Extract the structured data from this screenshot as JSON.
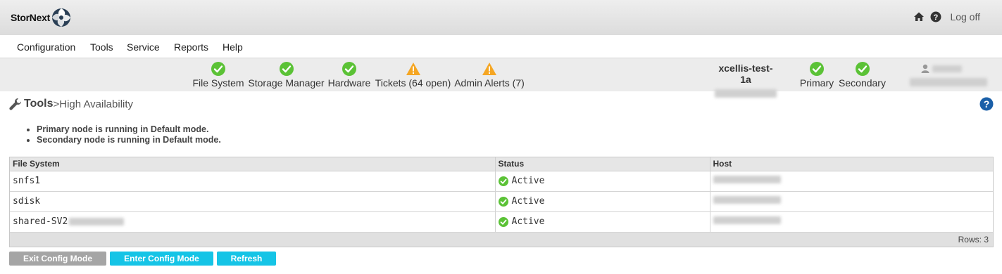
{
  "brand": {
    "name": "StorNext"
  },
  "header": {
    "logoff_label": "Log off",
    "home_icon": "home-icon",
    "help_icon": "question-circle-icon"
  },
  "menu": {
    "items": [
      {
        "label": "Configuration"
      },
      {
        "label": "Tools"
      },
      {
        "label": "Service"
      },
      {
        "label": "Reports"
      },
      {
        "label": "Help"
      }
    ]
  },
  "status": {
    "items": [
      {
        "label": "File System",
        "state": "ok"
      },
      {
        "label": "Storage Manager",
        "state": "ok"
      },
      {
        "label": "Hardware",
        "state": "ok"
      },
      {
        "label": "Tickets (64 open)",
        "state": "warning"
      },
      {
        "label": "Admin Alerts (7)",
        "state": "warning"
      }
    ],
    "host": {
      "name": "xcellis-test-1a"
    },
    "nodes": [
      {
        "label": "Primary",
        "state": "ok"
      },
      {
        "label": "Secondary",
        "state": "ok"
      }
    ],
    "colors": {
      "ok": "#5bc236",
      "warning": "#f5a623"
    }
  },
  "breadcrumb": {
    "section": "Tools",
    "separator": "> ",
    "page": "High Availability"
  },
  "messages": [
    "Primary node is running in Default mode.",
    "Secondary node is running in Default mode."
  ],
  "table": {
    "columns": [
      "File System",
      "Status",
      "Host"
    ],
    "rows": [
      {
        "file_system": "snfs1",
        "status": "Active"
      },
      {
        "file_system": "sdisk",
        "status": "Active"
      },
      {
        "file_system": "shared-SV2",
        "status": "Active"
      }
    ],
    "footer": "Rows: 3"
  },
  "buttons": {
    "exit_config": "Exit Config Mode",
    "enter_config": "Enter Config Mode",
    "refresh": "Refresh"
  },
  "accent_colors": {
    "button_cyan": "#15c4e6",
    "button_gray": "#a5a5a5",
    "help_blue": "#1a5fa8"
  }
}
